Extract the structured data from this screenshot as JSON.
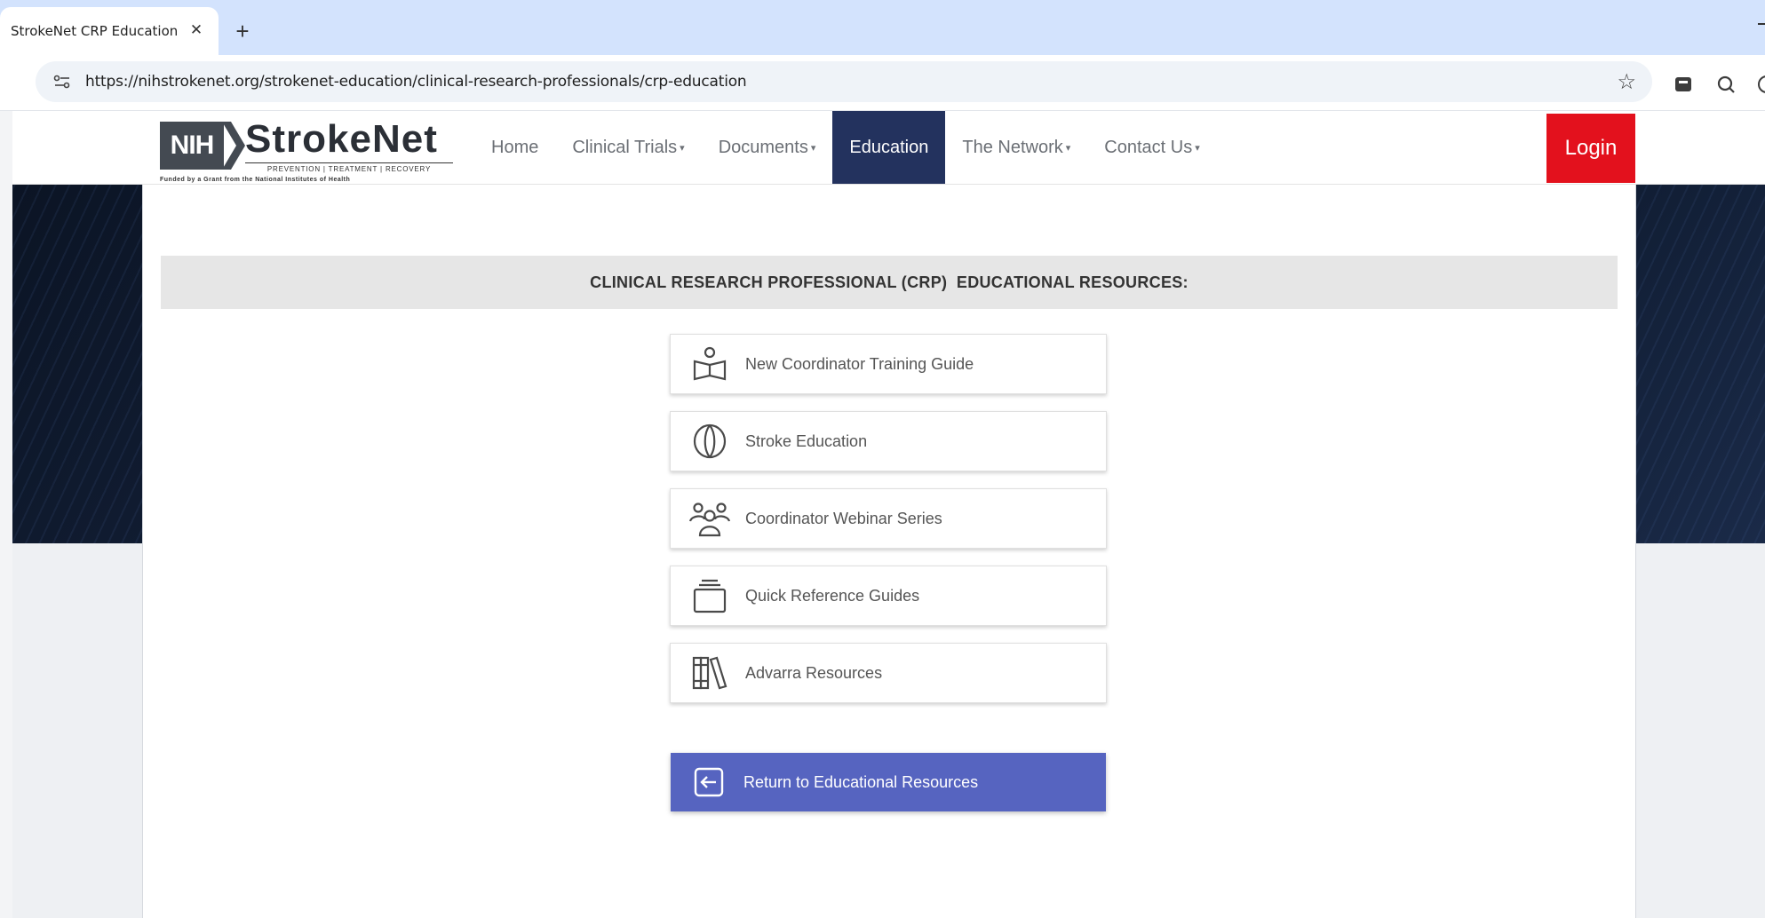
{
  "browser": {
    "tab_title": "StrokeNet CRP Education",
    "tab_close": "✕",
    "new_tab": "+",
    "url": "https://nihstrokenet.org/strokenet-education/clinical-research-professionals/crp-education",
    "icons": [
      "site-info-icon",
      "bookmark-star-icon",
      "extension-icon",
      "search-lens-icon",
      "profile-icon"
    ]
  },
  "logo": {
    "agency": "NIH",
    "name": "StrokeNet",
    "tagline": "PREVENTION  |  TREATMENT  |  RECOVERY",
    "funding": "Funded by a Grant from the National Institutes of Health"
  },
  "nav": {
    "items": [
      {
        "label": "Home",
        "dropdown": false
      },
      {
        "label": "Clinical Trials",
        "dropdown": true
      },
      {
        "label": "Documents",
        "dropdown": true
      },
      {
        "label": "Education",
        "dropdown": false,
        "active": true
      },
      {
        "label": "The Network",
        "dropdown": true
      },
      {
        "label": "Contact Us",
        "dropdown": true
      }
    ],
    "caret": "▾",
    "login": "Login"
  },
  "main": {
    "section_title": "CLINICAL RESEARCH PROFESSIONAL (CRP)  EDUCATIONAL RESOURCES:",
    "resources": [
      {
        "label": "New Coordinator Training Guide",
        "icon": "book-person-icon"
      },
      {
        "label": "Stroke Education",
        "icon": "brain-icon"
      },
      {
        "label": "Coordinator Webinar Series",
        "icon": "group-icon"
      },
      {
        "label": "Quick Reference Guides",
        "icon": "stack-icon"
      },
      {
        "label": "Advarra Resources",
        "icon": "library-books-icon"
      }
    ],
    "return_button": "Return to Educational Resources",
    "return_icon": "arrow-left-box-icon"
  },
  "colors": {
    "nav_active": "#23325e",
    "login": "#e3111d",
    "return_button": "#5664c0",
    "tab_strip": "#d3e3fd"
  }
}
